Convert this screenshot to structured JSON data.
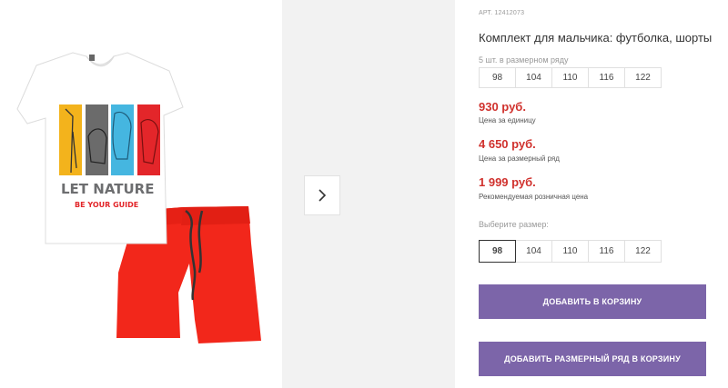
{
  "product": {
    "sku": "АРТ. 12412073",
    "title": "Комплект для мальчика: футболка, шорты",
    "tshirt_print": {
      "line1": "LET NATURE",
      "line2": "BE YOUR GUIDE"
    }
  },
  "size_row": {
    "label": "5 шт. в размерном ряду",
    "sizes": [
      "98",
      "104",
      "110",
      "116",
      "122"
    ]
  },
  "prices": {
    "unit_price": "930 руб.",
    "unit_label": "Цена за единицу",
    "row_price": "4 650 руб.",
    "row_label": "Цена за размерный ряд",
    "retail_price": "1 999 руб.",
    "retail_label": "Рекомендуемая розничная цена"
  },
  "size_picker": {
    "label": "Выберите размер:",
    "sizes": [
      "98",
      "104",
      "110",
      "116",
      "122"
    ],
    "selected": "98"
  },
  "buttons": {
    "add_to_cart": "ДОБАВИТЬ В КОРЗИНУ",
    "add_row_to_cart": "ДОБАВИТЬ РАЗМЕРНЫЙ РЯД В КОРЗИНУ"
  },
  "colors": {
    "price": "#d0312d",
    "button": "#7c65a9",
    "shorts": "#f2271b"
  },
  "icons": {
    "next": "chevron-right-icon"
  }
}
